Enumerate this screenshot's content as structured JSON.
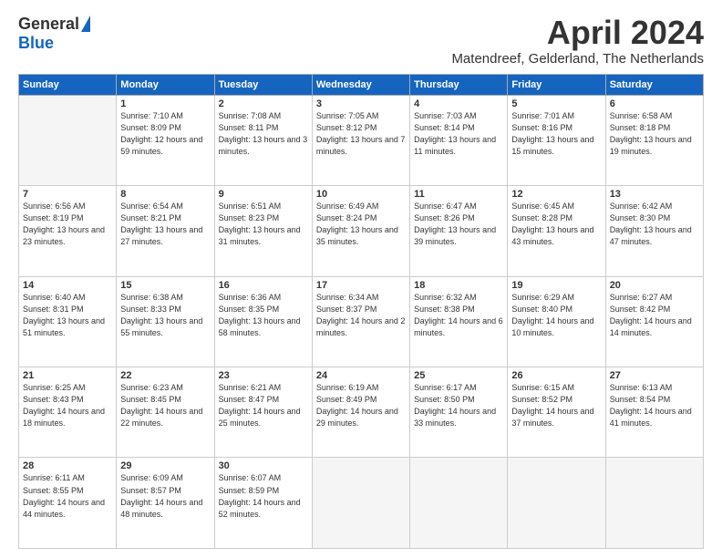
{
  "logo": {
    "general": "General",
    "blue": "Blue"
  },
  "header": {
    "title": "April 2024",
    "subtitle": "Matendreef, Gelderland, The Netherlands"
  },
  "weekdays": [
    "Sunday",
    "Monday",
    "Tuesday",
    "Wednesday",
    "Thursday",
    "Friday",
    "Saturday"
  ],
  "weeks": [
    [
      {
        "day": "",
        "sunrise": "",
        "sunset": "",
        "daylight": ""
      },
      {
        "day": "1",
        "sunrise": "Sunrise: 7:10 AM",
        "sunset": "Sunset: 8:09 PM",
        "daylight": "Daylight: 12 hours and 59 minutes."
      },
      {
        "day": "2",
        "sunrise": "Sunrise: 7:08 AM",
        "sunset": "Sunset: 8:11 PM",
        "daylight": "Daylight: 13 hours and 3 minutes."
      },
      {
        "day": "3",
        "sunrise": "Sunrise: 7:05 AM",
        "sunset": "Sunset: 8:12 PM",
        "daylight": "Daylight: 13 hours and 7 minutes."
      },
      {
        "day": "4",
        "sunrise": "Sunrise: 7:03 AM",
        "sunset": "Sunset: 8:14 PM",
        "daylight": "Daylight: 13 hours and 11 minutes."
      },
      {
        "day": "5",
        "sunrise": "Sunrise: 7:01 AM",
        "sunset": "Sunset: 8:16 PM",
        "daylight": "Daylight: 13 hours and 15 minutes."
      },
      {
        "day": "6",
        "sunrise": "Sunrise: 6:58 AM",
        "sunset": "Sunset: 8:18 PM",
        "daylight": "Daylight: 13 hours and 19 minutes."
      }
    ],
    [
      {
        "day": "7",
        "sunrise": "Sunrise: 6:56 AM",
        "sunset": "Sunset: 8:19 PM",
        "daylight": "Daylight: 13 hours and 23 minutes."
      },
      {
        "day": "8",
        "sunrise": "Sunrise: 6:54 AM",
        "sunset": "Sunset: 8:21 PM",
        "daylight": "Daylight: 13 hours and 27 minutes."
      },
      {
        "day": "9",
        "sunrise": "Sunrise: 6:51 AM",
        "sunset": "Sunset: 8:23 PM",
        "daylight": "Daylight: 13 hours and 31 minutes."
      },
      {
        "day": "10",
        "sunrise": "Sunrise: 6:49 AM",
        "sunset": "Sunset: 8:24 PM",
        "daylight": "Daylight: 13 hours and 35 minutes."
      },
      {
        "day": "11",
        "sunrise": "Sunrise: 6:47 AM",
        "sunset": "Sunset: 8:26 PM",
        "daylight": "Daylight: 13 hours and 39 minutes."
      },
      {
        "day": "12",
        "sunrise": "Sunrise: 6:45 AM",
        "sunset": "Sunset: 8:28 PM",
        "daylight": "Daylight: 13 hours and 43 minutes."
      },
      {
        "day": "13",
        "sunrise": "Sunrise: 6:42 AM",
        "sunset": "Sunset: 8:30 PM",
        "daylight": "Daylight: 13 hours and 47 minutes."
      }
    ],
    [
      {
        "day": "14",
        "sunrise": "Sunrise: 6:40 AM",
        "sunset": "Sunset: 8:31 PM",
        "daylight": "Daylight: 13 hours and 51 minutes."
      },
      {
        "day": "15",
        "sunrise": "Sunrise: 6:38 AM",
        "sunset": "Sunset: 8:33 PM",
        "daylight": "Daylight: 13 hours and 55 minutes."
      },
      {
        "day": "16",
        "sunrise": "Sunrise: 6:36 AM",
        "sunset": "Sunset: 8:35 PM",
        "daylight": "Daylight: 13 hours and 58 minutes."
      },
      {
        "day": "17",
        "sunrise": "Sunrise: 6:34 AM",
        "sunset": "Sunset: 8:37 PM",
        "daylight": "Daylight: 14 hours and 2 minutes."
      },
      {
        "day": "18",
        "sunrise": "Sunrise: 6:32 AM",
        "sunset": "Sunset: 8:38 PM",
        "daylight": "Daylight: 14 hours and 6 minutes."
      },
      {
        "day": "19",
        "sunrise": "Sunrise: 6:29 AM",
        "sunset": "Sunset: 8:40 PM",
        "daylight": "Daylight: 14 hours and 10 minutes."
      },
      {
        "day": "20",
        "sunrise": "Sunrise: 6:27 AM",
        "sunset": "Sunset: 8:42 PM",
        "daylight": "Daylight: 14 hours and 14 minutes."
      }
    ],
    [
      {
        "day": "21",
        "sunrise": "Sunrise: 6:25 AM",
        "sunset": "Sunset: 8:43 PM",
        "daylight": "Daylight: 14 hours and 18 minutes."
      },
      {
        "day": "22",
        "sunrise": "Sunrise: 6:23 AM",
        "sunset": "Sunset: 8:45 PM",
        "daylight": "Daylight: 14 hours and 22 minutes."
      },
      {
        "day": "23",
        "sunrise": "Sunrise: 6:21 AM",
        "sunset": "Sunset: 8:47 PM",
        "daylight": "Daylight: 14 hours and 25 minutes."
      },
      {
        "day": "24",
        "sunrise": "Sunrise: 6:19 AM",
        "sunset": "Sunset: 8:49 PM",
        "daylight": "Daylight: 14 hours and 29 minutes."
      },
      {
        "day": "25",
        "sunrise": "Sunrise: 6:17 AM",
        "sunset": "Sunset: 8:50 PM",
        "daylight": "Daylight: 14 hours and 33 minutes."
      },
      {
        "day": "26",
        "sunrise": "Sunrise: 6:15 AM",
        "sunset": "Sunset: 8:52 PM",
        "daylight": "Daylight: 14 hours and 37 minutes."
      },
      {
        "day": "27",
        "sunrise": "Sunrise: 6:13 AM",
        "sunset": "Sunset: 8:54 PM",
        "daylight": "Daylight: 14 hours and 41 minutes."
      }
    ],
    [
      {
        "day": "28",
        "sunrise": "Sunrise: 6:11 AM",
        "sunset": "Sunset: 8:55 PM",
        "daylight": "Daylight: 14 hours and 44 minutes."
      },
      {
        "day": "29",
        "sunrise": "Sunrise: 6:09 AM",
        "sunset": "Sunset: 8:57 PM",
        "daylight": "Daylight: 14 hours and 48 minutes."
      },
      {
        "day": "30",
        "sunrise": "Sunrise: 6:07 AM",
        "sunset": "Sunset: 8:59 PM",
        "daylight": "Daylight: 14 hours and 52 minutes."
      },
      {
        "day": "",
        "sunrise": "",
        "sunset": "",
        "daylight": ""
      },
      {
        "day": "",
        "sunrise": "",
        "sunset": "",
        "daylight": ""
      },
      {
        "day": "",
        "sunrise": "",
        "sunset": "",
        "daylight": ""
      },
      {
        "day": "",
        "sunrise": "",
        "sunset": "",
        "daylight": ""
      }
    ]
  ]
}
